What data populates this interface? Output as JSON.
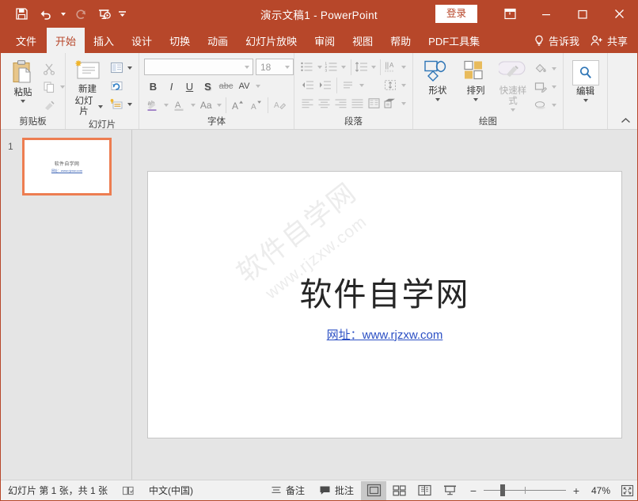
{
  "titlebar": {
    "quick_access": [
      {
        "name": "save",
        "icon": "save-icon"
      },
      {
        "name": "undo",
        "icon": "undo-icon"
      },
      {
        "name": "redo",
        "icon": "redo-icon"
      },
      {
        "name": "start-from-beginning",
        "icon": "slideshow-icon"
      },
      {
        "name": "customize-quick-access-toolbar",
        "icon": "chevron-down-icon"
      }
    ],
    "title": "演示文稿1  -  PowerPoint",
    "signin_label": "登录",
    "ribbon_display_options": "ribbon-display-icon",
    "minimize": "−",
    "maximize": "☐",
    "close": "✕"
  },
  "tabs": [
    {
      "label": "文件",
      "active": false
    },
    {
      "label": "开始",
      "active": true
    },
    {
      "label": "插入",
      "active": false
    },
    {
      "label": "设计",
      "active": false
    },
    {
      "label": "切换",
      "active": false
    },
    {
      "label": "动画",
      "active": false
    },
    {
      "label": "幻灯片放映",
      "active": false
    },
    {
      "label": "审阅",
      "active": false
    },
    {
      "label": "视图",
      "active": false
    },
    {
      "label": "帮助",
      "active": false
    },
    {
      "label": "PDF工具集",
      "active": false
    }
  ],
  "tellme_label": "告诉我",
  "share_label": "共享",
  "ribbon": {
    "clipboard": {
      "label": "剪贴板",
      "paste_label": "粘贴",
      "cut_name": "cut-icon",
      "copy_name": "copy-icon",
      "format_painter_name": "format-painter-icon"
    },
    "slides": {
      "label": "幻灯片",
      "new_slide_label_line1": "新建",
      "new_slide_label_line2": "幻灯片",
      "layout_name": "layout-icon",
      "reset_name": "reset-icon",
      "section_name": "section-icon"
    },
    "font": {
      "label": "字体",
      "font_name_value": "",
      "font_name_placeholder": "",
      "font_size_value": "18",
      "bold": "B",
      "italic": "I",
      "underline": "U",
      "shadow": "S",
      "strikethrough": "abc",
      "char_spacing": "AV",
      "text_highlight": "ab",
      "font_color": "A",
      "change_case": "Aa",
      "increase_size": "A",
      "decrease_size": "A",
      "clear_formatting": "clear-formatting-icon"
    },
    "paragraph": {
      "label": "段落",
      "bullets": "bullets-icon",
      "numbering": "numbering-icon",
      "line_spacing": "line-spacing-icon",
      "text_direction": "text-direction-icon",
      "decrease_indent": "decrease-indent-icon",
      "increase_indent": "increase-indent-icon",
      "paragraph_spacing": "paragraph-spacing-icon",
      "align_text": "align-text-icon",
      "align_left": "align-left-icon",
      "align_center": "align-center-icon",
      "align_right": "align-right-icon",
      "justify": "justify-icon",
      "columns": "columns-icon",
      "smartart": "smartart-icon"
    },
    "drawing": {
      "label": "绘图",
      "shapes_label": "形状",
      "arrange_label": "排列",
      "quickstyles_label": "快速样式",
      "shape_fill": "shape-fill-icon",
      "shape_outline": "shape-outline-icon",
      "shape_effects": "shape-effects-icon"
    },
    "editing": {
      "label": "编辑",
      "find_name": "search-icon"
    },
    "collapse_ribbon": "chevron-up-icon"
  },
  "thumbnails": [
    {
      "number": "1",
      "title": "软件自学网",
      "subtitle": "网址：www.rjzxw.com",
      "selected": true
    }
  ],
  "slide": {
    "title": "软件自学网",
    "subtitle": "网址：www.rjzxw.com",
    "watermark_line1": "软件自学网",
    "watermark_line2": "www.rjzxw.com"
  },
  "statusbar": {
    "slide_count_text": "幻灯片 第 1 张，共 1 张",
    "spellcheck_icon": "spellcheck-icon",
    "language": "中文(中国)",
    "notes_label": "备注",
    "comments_label": "批注",
    "views": [
      {
        "name": "normal-view",
        "icon": "normal-view-icon",
        "active": true
      },
      {
        "name": "slide-sorter-view",
        "icon": "slide-sorter-icon",
        "active": false
      },
      {
        "name": "reading-view",
        "icon": "reading-view-icon",
        "active": false
      },
      {
        "name": "slideshow-view",
        "icon": "slideshow-play-icon",
        "active": false
      }
    ],
    "zoom_out": "−",
    "zoom_in": "+",
    "zoom_percent": "47%",
    "fit_to_window": "fit-window-icon"
  },
  "colors": {
    "accent": "#b7472a",
    "thumb_selection": "#ed7d51",
    "hyperlink": "#2b4fc4",
    "workspace_bg": "#e5e5e5"
  }
}
